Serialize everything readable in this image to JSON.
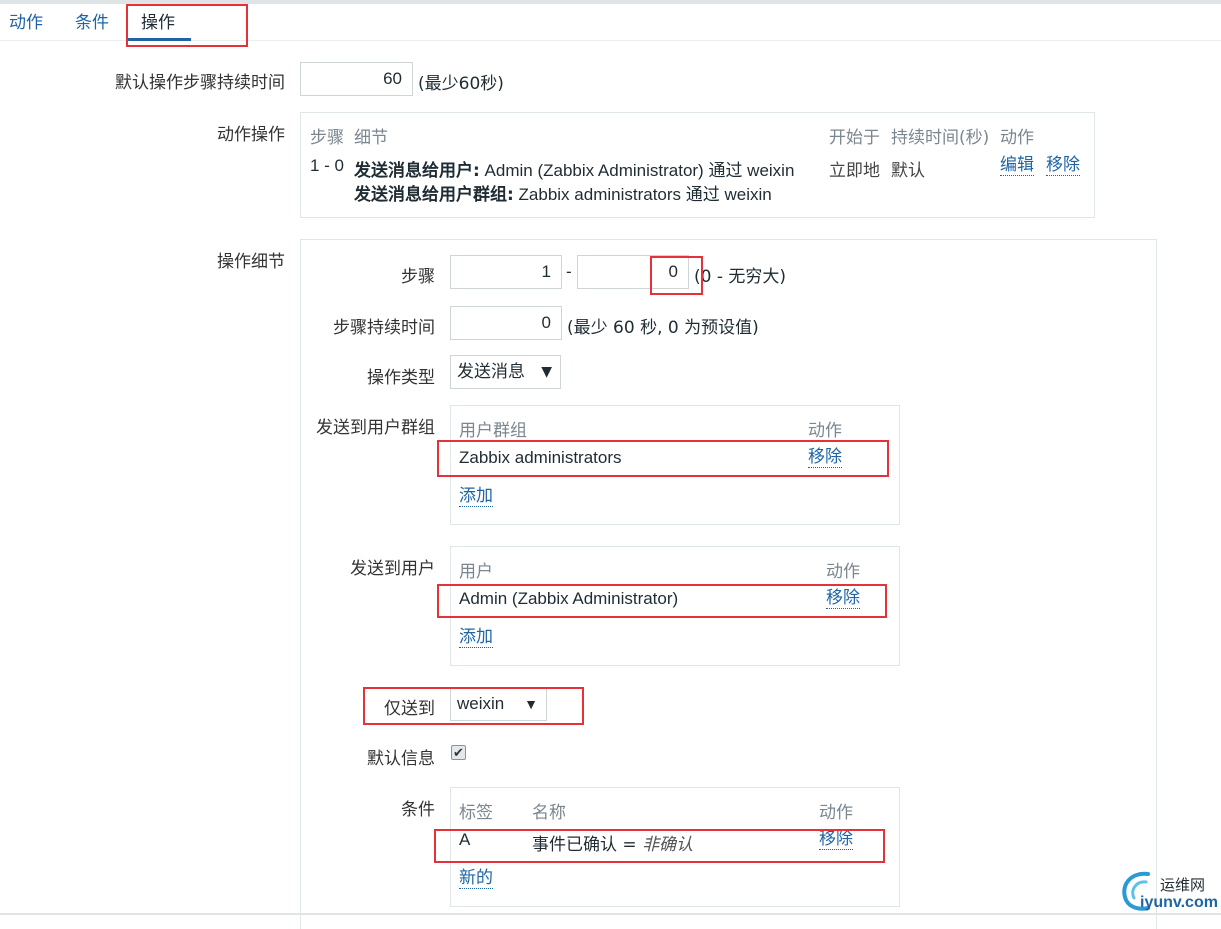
{
  "tabs": [
    {
      "label": "动作"
    },
    {
      "label": "条件"
    },
    {
      "label": "操作"
    }
  ],
  "default_step_duration": {
    "label": "默认操作步骤持续时间",
    "value": "60",
    "hint": "(最少60秒)"
  },
  "operations": {
    "label": "动作操作",
    "headers": {
      "steps": "步骤",
      "details": "细节",
      "start": "开始于",
      "duration": "持续时间(秒)",
      "action": "动作"
    },
    "row": {
      "steps": "1 - 0",
      "detail1_bold": "发送消息给用户:",
      "detail1_text": " Admin (Zabbix Administrator) 通过 weixin",
      "detail2_bold": "发送消息给用户群组:",
      "detail2_text": " Zabbix administrators 通过 weixin",
      "start": "立即地",
      "duration": "默认",
      "edit": "编辑",
      "remove": "移除"
    }
  },
  "op_details": {
    "label": "操作细节",
    "steps": {
      "label": "步骤",
      "from": "1",
      "dash": "-",
      "to": "0",
      "hint": "(0 - 无穷大)"
    },
    "step_duration": {
      "label": "步骤持续时间",
      "value": "0",
      "hint": "(最少 60 秒, 0 为预设值)"
    },
    "op_type": {
      "label": "操作类型",
      "value": "发送消息"
    },
    "user_groups": {
      "label": "发送到用户群组",
      "header_name": "用户群组",
      "header_action": "动作",
      "item": "Zabbix administrators",
      "remove": "移除",
      "add": "添加"
    },
    "users": {
      "label": "发送到用户",
      "header_name": "用户",
      "header_action": "动作",
      "item": "Admin (Zabbix Administrator)",
      "remove": "移除",
      "add": "添加"
    },
    "send_only_to": {
      "label": "仅送到",
      "value": "weixin"
    },
    "default_message": {
      "label": "默认信息",
      "checked": true
    },
    "conditions": {
      "label": "条件",
      "header_label": "标签",
      "header_name": "名称",
      "header_action": "动作",
      "row_label": "A",
      "row_name": "事件已确认 = ",
      "row_value": "非确认",
      "remove": "移除",
      "new": "新的"
    }
  },
  "watermark": {
    "top": "运维网",
    "bottom": "iyunv.com"
  },
  "colors": {
    "link": "#1f65a6",
    "highlight": "#e53238"
  }
}
